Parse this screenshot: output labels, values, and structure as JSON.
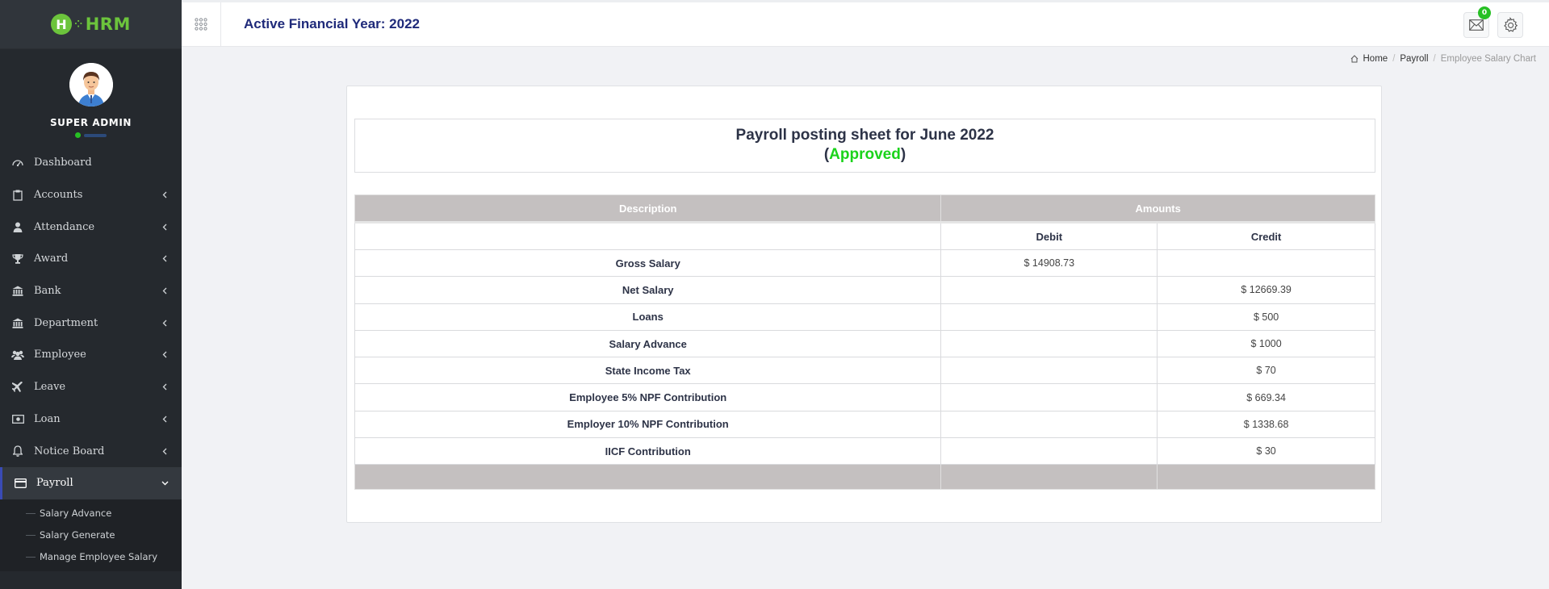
{
  "app": {
    "logo_text": "HRM",
    "logo_letter": "H",
    "accent": "#6cc43c",
    "user_role": "SUPER ADMIN"
  },
  "sidebar": {
    "items": [
      {
        "label": "Dashboard",
        "icon": "dashboard-icon",
        "has_children": false
      },
      {
        "label": "Accounts",
        "icon": "clipboard-icon",
        "has_children": true
      },
      {
        "label": "Attendance",
        "icon": "user-icon",
        "has_children": true
      },
      {
        "label": "Award",
        "icon": "trophy-icon",
        "has_children": true
      },
      {
        "label": "Bank",
        "icon": "bank-icon",
        "has_children": true
      },
      {
        "label": "Department",
        "icon": "building-icon",
        "has_children": true
      },
      {
        "label": "Employee",
        "icon": "users-icon",
        "has_children": true
      },
      {
        "label": "Leave",
        "icon": "plane-icon",
        "has_children": true
      },
      {
        "label": "Loan",
        "icon": "money-icon",
        "has_children": true
      },
      {
        "label": "Notice Board",
        "icon": "bell-icon",
        "has_children": true
      },
      {
        "label": "Payroll",
        "icon": "credit-card-icon",
        "has_children": true,
        "active": true
      }
    ],
    "payroll_submenu": [
      "Salary Advance",
      "Salary Generate",
      "Manage Employee Salary"
    ]
  },
  "header": {
    "title": "Active Financial Year: 2022",
    "mail_count": "0"
  },
  "breadcrumb": {
    "home": "Home",
    "section": "Payroll",
    "current": "Employee Salary Chart"
  },
  "sheet": {
    "title": "Payroll posting sheet for June 2022",
    "open_paren": "(",
    "status": "Approved",
    "close_paren": ")",
    "status_color": "#1bd31b"
  },
  "table": {
    "headers": {
      "description": "Description",
      "amounts": "Amounts",
      "debit": "Debit",
      "credit": "Credit"
    },
    "rows": [
      {
        "description": "Gross Salary",
        "debit": "$ 14908.73",
        "credit": ""
      },
      {
        "description": "Net Salary",
        "debit": "",
        "credit": "$ 12669.39"
      },
      {
        "description": "Loans",
        "debit": "",
        "credit": "$ 500"
      },
      {
        "description": "Salary Advance",
        "debit": "",
        "credit": "$ 1000"
      },
      {
        "description": "State Income Tax",
        "debit": "",
        "credit": "$ 70"
      },
      {
        "description": "Employee 5% NPF Contribution",
        "debit": "",
        "credit": "$ 669.34"
      },
      {
        "description": "Employer 10% NPF Contribution",
        "debit": "",
        "credit": "$ 1338.68"
      },
      {
        "description": "IICF Contribution",
        "debit": "",
        "credit": "$ 30"
      }
    ]
  }
}
